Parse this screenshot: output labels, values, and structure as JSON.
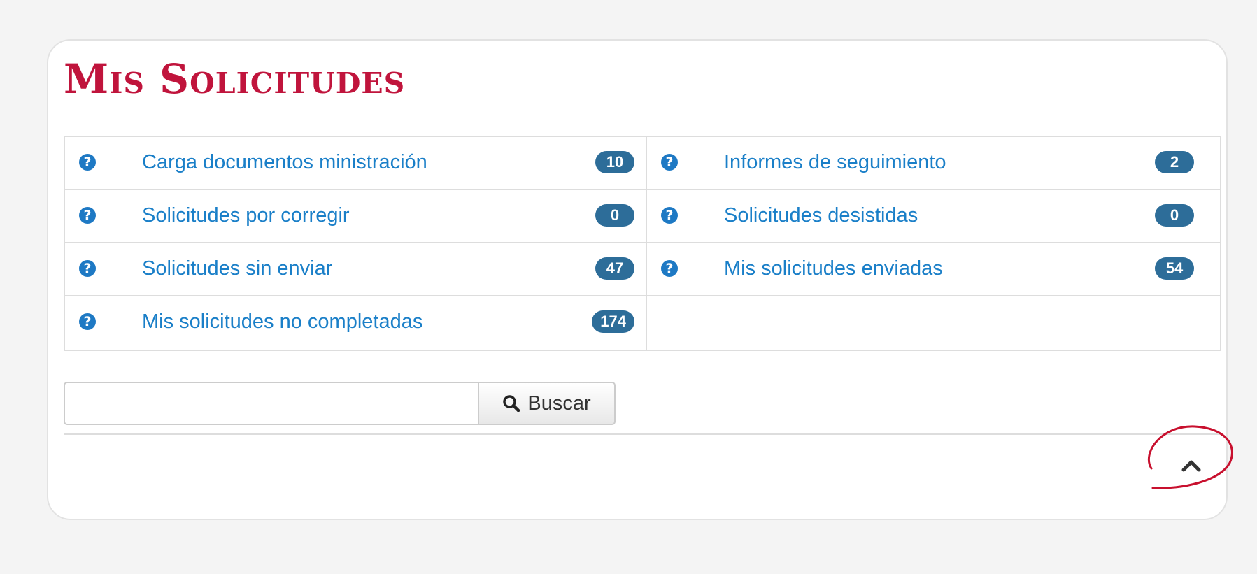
{
  "panel": {
    "title": "Mis Solicitudes"
  },
  "items": [
    {
      "label": "Carga documentos ministración",
      "count": "10",
      "icon": "question-circle-icon"
    },
    {
      "label": "Informes de seguimiento",
      "count": "2",
      "icon": "question-circle-icon"
    },
    {
      "label": "Solicitudes por corregir",
      "count": "0",
      "icon": "question-circle-icon"
    },
    {
      "label": "Solicitudes desistidas",
      "count": "0",
      "icon": "question-circle-icon"
    },
    {
      "label": "Solicitudes sin enviar",
      "count": "47",
      "icon": "question-circle-icon"
    },
    {
      "label": "Mis solicitudes enviadas",
      "count": "54",
      "icon": "question-circle-icon"
    },
    {
      "label": "Mis solicitudes no completadas",
      "count": "174",
      "icon": "question-circle-icon"
    }
  ],
  "search": {
    "value": "",
    "placeholder": "",
    "button_label": "Buscar"
  },
  "icons": {
    "help_glyph": "?",
    "collapse": "chevron-up-icon"
  },
  "colors": {
    "title": "#c0143c",
    "link": "#1a7fc8",
    "badge": "#2d6d99",
    "annotation": "#c8102e"
  }
}
